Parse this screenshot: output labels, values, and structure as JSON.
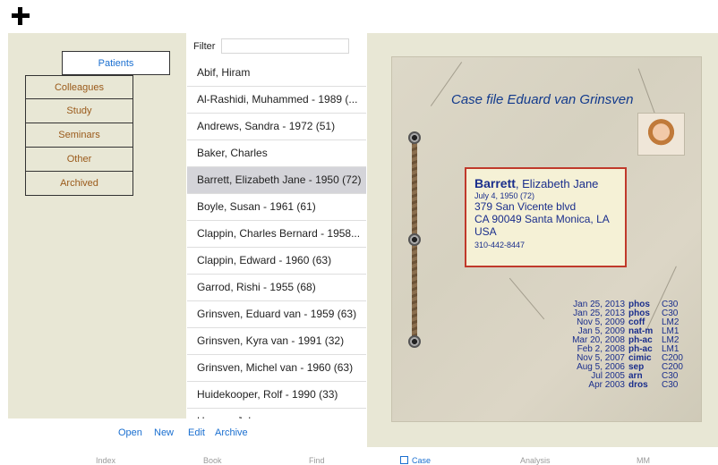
{
  "categories": {
    "active": "Patients",
    "items": [
      "Colleagues",
      "Study",
      "Seminars",
      "Other",
      "Archived"
    ]
  },
  "filter": {
    "label": "Filter",
    "value": ""
  },
  "patients": [
    "Abif, Hiram",
    "Al-Rashidi, Muhammed - 1989 (...",
    "Andrews, Sandra - 1972 (51)",
    "Baker, Charles",
    "Barrett, Elizabeth Jane - 1950 (72)",
    "Boyle, Susan - 1961 (61)",
    "Clappin, Charles Bernard - 1958...",
    "Clappin, Edward - 1960 (63)",
    "Garrod, Rishi - 1955 (68)",
    "Grinsven, Eduard van - 1959 (63)",
    "Grinsven, Kyra van - 1991 (32)",
    "Grinsven, Michel van - 1960 (63)",
    "Huidekooper, Rolf - 1990 (33)",
    "Hyman, John"
  ],
  "selected_patient_index": 4,
  "toolbar": {
    "open": "Open",
    "new": "New",
    "edit": "Edit",
    "archive": "Archive"
  },
  "case": {
    "title": "Case file Eduard van Grinsven",
    "surname": "Barrett",
    "given_names": ", Elizabeth Jane",
    "birth": "July 4, 1950 (72)",
    "address1": "379 San Vicente blvd",
    "address2": "CA 90049  Santa Monica, LA",
    "country": "USA",
    "phone": "310-442-8447"
  },
  "prescriptions": [
    {
      "date": "Jan 25, 2013",
      "remedy": "phos",
      "potency": "C30"
    },
    {
      "date": "Jan 25, 2013",
      "remedy": "phos",
      "potency": "C30"
    },
    {
      "date": "Nov 5, 2009",
      "remedy": "coff",
      "potency": "LM2"
    },
    {
      "date": "Jan 5, 2009",
      "remedy": "nat-m",
      "potency": "LM1"
    },
    {
      "date": "Mar 20, 2008",
      "remedy": "ph-ac",
      "potency": "LM2"
    },
    {
      "date": "Feb 2, 2008",
      "remedy": "ph-ac",
      "potency": "LM1"
    },
    {
      "date": "Nov 5, 2007",
      "remedy": "cimic",
      "potency": "C200"
    },
    {
      "date": "Aug 5, 2006",
      "remedy": "sep",
      "potency": "C200"
    },
    {
      "date": "Jul 2005",
      "remedy": "arn",
      "potency": "C30"
    },
    {
      "date": "Apr 2003",
      "remedy": "dros",
      "potency": "C30"
    }
  ],
  "tabs": {
    "index": "Index",
    "book": "Book",
    "find": "Find",
    "case": "Case",
    "analysis": "Analysis",
    "mm": "MM",
    "active": "case"
  },
  "colors": {
    "accent": "#1a6fd0",
    "folder_text": "#9a5a1a",
    "pane_bg": "#e8e7d5",
    "card_border": "#c0392b",
    "case_text": "#1a2e8c"
  },
  "icons": {
    "add": "plus-icon",
    "case_tab": "case-file-icon"
  }
}
